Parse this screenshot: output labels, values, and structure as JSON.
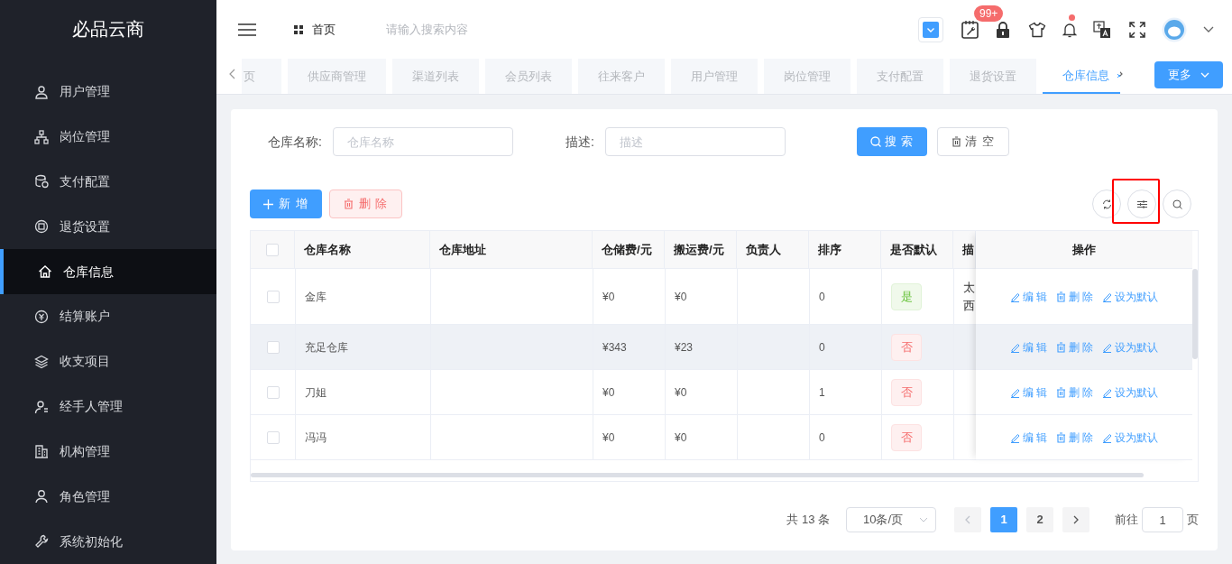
{
  "sidebar": {
    "logo": "必品云商",
    "items": [
      {
        "label": "用户管理",
        "kind": "user",
        "selected": false
      },
      {
        "label": "岗位管理",
        "kind": "org",
        "selected": false
      },
      {
        "label": "支付配置",
        "kind": "coins",
        "selected": false
      },
      {
        "label": "退货设置",
        "kind": "return",
        "selected": false
      },
      {
        "label": "仓库信息",
        "kind": "home",
        "selected": true
      },
      {
        "label": "结算账户",
        "kind": "money",
        "selected": false
      },
      {
        "label": "收支项目",
        "kind": "layers",
        "selected": false
      },
      {
        "label": "经手人管理",
        "kind": "person",
        "selected": false
      },
      {
        "label": "机构管理",
        "kind": "building",
        "selected": false
      },
      {
        "label": "角色管理",
        "kind": "role",
        "selected": false
      },
      {
        "label": "系统初始化",
        "kind": "wrench",
        "selected": false
      }
    ]
  },
  "header": {
    "breadcrumb": "首页",
    "search": {
      "placeholder": "请输入搜索内容"
    },
    "badge": "99+",
    "notification_dot": true
  },
  "tabs": {
    "items": [
      {
        "label": "页",
        "selected": false
      },
      {
        "label": "供应商管理",
        "selected": false
      },
      {
        "label": "渠道列表",
        "selected": false
      },
      {
        "label": "会员列表",
        "selected": false
      },
      {
        "label": "往来客户",
        "selected": false
      },
      {
        "label": "用户管理",
        "selected": false
      },
      {
        "label": "岗位管理",
        "selected": false
      },
      {
        "label": "支付配置",
        "selected": false
      },
      {
        "label": "退货设置",
        "selected": false
      },
      {
        "label": "仓库信息",
        "selected": true
      }
    ],
    "more": "更多"
  },
  "filters": [
    {
      "label": "仓库名称:",
      "placeholder": "仓库名称"
    },
    {
      "label": "描述:",
      "placeholder": "描述"
    }
  ],
  "filter_buttons": [
    {
      "label": "搜 索",
      "kind": "primary"
    },
    {
      "label": "清 空",
      "kind": "plain"
    }
  ],
  "toolbar": [
    {
      "label": "新 增",
      "kind": "primary"
    },
    {
      "label": "删 除",
      "kind": "danger"
    }
  ],
  "table": {
    "select_all_checked": false,
    "columns": [
      "仓库名称",
      "仓库地址",
      "仓储费/元",
      "搬运费/元",
      "负责人",
      "排序",
      "是否默认",
      "描",
      "操作"
    ],
    "rows": [
      {
        "checked": false,
        "name": "金库",
        "storage_fee": "¥0",
        "carry_fee": "¥0",
        "sort": "0",
        "default": true,
        "default_label": "是",
        "description_lines": [
          "太",
          "西"
        ],
        "highlighted": false,
        "actions": [
          "编 辑",
          "删 除",
          "设为默认"
        ]
      },
      {
        "checked": false,
        "name": "充足仓库",
        "storage_fee": "¥343",
        "carry_fee": "¥23",
        "sort": "0",
        "default": false,
        "default_label": "否",
        "highlighted": true,
        "actions": [
          "编 辑",
          "删 除",
          "设为默认"
        ]
      },
      {
        "checked": false,
        "name": "刀姐",
        "storage_fee": "¥0",
        "carry_fee": "¥0",
        "sort": "1",
        "default": false,
        "default_label": "否",
        "highlighted": false,
        "actions": [
          "编 辑",
          "删 除",
          "设为默认"
        ]
      },
      {
        "checked": false,
        "name": "冯冯",
        "storage_fee": "¥0",
        "carry_fee": "¥0",
        "sort": "0",
        "default": false,
        "default_label": "否",
        "highlighted": false,
        "actions": [
          "编 辑",
          "删 除",
          "设为默认"
        ]
      }
    ]
  },
  "pagination": {
    "total": "共 13 条",
    "page_size": "10条/页",
    "pages": [
      {
        "label": "1",
        "selected": true
      },
      {
        "label": "2",
        "selected": false
      }
    ],
    "goto_label": "前往",
    "goto_value": "1",
    "goto_suffix": "页"
  }
}
